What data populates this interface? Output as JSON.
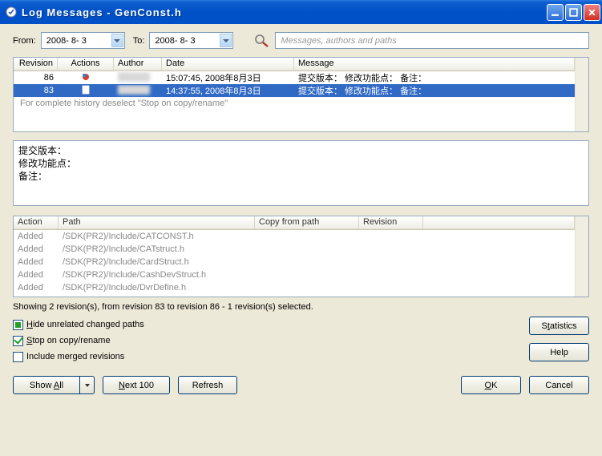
{
  "window": {
    "title": "Log Messages - GenConst.h"
  },
  "filter": {
    "from_label": "From:",
    "to_label": "To:",
    "date_from": "2008- 8- 3",
    "date_to": "2008- 8- 3",
    "search_placeholder": "Messages, authors and paths"
  },
  "revisions": {
    "headers": {
      "rev": "Revision",
      "actions": "Actions",
      "author": "Author",
      "date": "Date",
      "msg": "Message"
    },
    "rows": [
      {
        "rev": "86",
        "action_icon": "modify-replace",
        "author": "",
        "date": "15:07:45, 2008年8月3日",
        "msg": "提交版本： 修改功能点： 备注：",
        "selected": false
      },
      {
        "rev": "83",
        "action_icon": "add",
        "author": "",
        "date": "14:37:55, 2008年8月3日",
        "msg": "提交版本： 修改功能点： 备注：",
        "selected": true
      }
    ],
    "hint": "For complete history deselect \"Stop on copy/rename\""
  },
  "detail": {
    "line1": "提交版本：",
    "line2": "修改功能点：",
    "line3": "备注："
  },
  "paths": {
    "headers": {
      "action": "Action",
      "path": "Path",
      "copy": "Copy from path",
      "rev": "Revision"
    },
    "rows": [
      {
        "action": "Added",
        "path": "/SDK(PR2)/Include/CATCONST.h"
      },
      {
        "action": "Added",
        "path": "/SDK(PR2)/Include/CATstruct.h"
      },
      {
        "action": "Added",
        "path": "/SDK(PR2)/Include/CardStruct.h"
      },
      {
        "action": "Added",
        "path": "/SDK(PR2)/Include/CashDevStruct.h"
      },
      {
        "action": "Added",
        "path": "/SDK(PR2)/Include/DvrDefine.h"
      }
    ]
  },
  "status": "Showing 2 revision(s), from revision 83 to revision 86 - 1 revision(s) selected.",
  "checks": {
    "hide": "Hide unrelated changed paths",
    "stop": "Stop on copy/rename",
    "merged": "Include merged revisions"
  },
  "buttons": {
    "statistics": "Statistics",
    "help": "Help",
    "showall": "Show All",
    "next100": "Next 100",
    "refresh": "Refresh",
    "ok": "OK",
    "cancel": "Cancel"
  }
}
